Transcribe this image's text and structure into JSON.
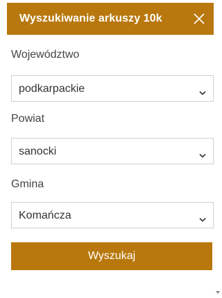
{
  "header": {
    "title": "Wyszukiwanie arkuszy 10k",
    "close_icon": "close-icon"
  },
  "fields": [
    {
      "label": "Województwo",
      "value": "podkarpackie"
    },
    {
      "label": "Powiat",
      "value": "sanocki"
    },
    {
      "label": "Gmina",
      "value": "Komańcza"
    }
  ],
  "search_button": {
    "label": "Wyszukaj"
  },
  "colors": {
    "accent": "#b8780d",
    "header_text": "#ffffff",
    "label_text": "#444444",
    "select_border": "#d0d0d0"
  },
  "icons": {
    "dropdown": "chevron-down-icon",
    "scroll": "scroll-down-arrow-icon"
  }
}
